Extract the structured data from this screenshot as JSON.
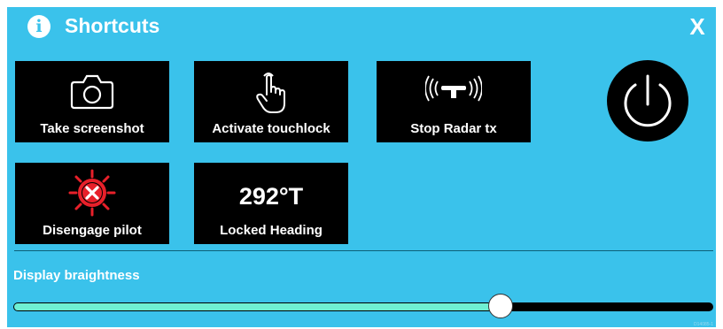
{
  "header": {
    "info_glyph": "i",
    "title": "Shortcuts",
    "close_label": "X"
  },
  "tiles": [
    {
      "label": "Take screenshot",
      "icon": "camera-icon"
    },
    {
      "label": "Activate touchlock",
      "icon": "touch-hand-icon"
    },
    {
      "label": "Stop Radar tx",
      "icon": "radar-antenna-icon"
    },
    {
      "label": "Disengage pilot",
      "icon": "helm-cross-icon"
    },
    {
      "label": "Locked Heading",
      "value": "292°T"
    }
  ],
  "power": {
    "icon": "power-icon"
  },
  "brightness": {
    "label": "Display braightness",
    "level": 0.696
  },
  "footnote": "D14085-1",
  "colors": {
    "panel": "#3ac2eb",
    "tile": "#000000",
    "slider_fill": "#6ff0d3",
    "alert": "#e8202a"
  }
}
